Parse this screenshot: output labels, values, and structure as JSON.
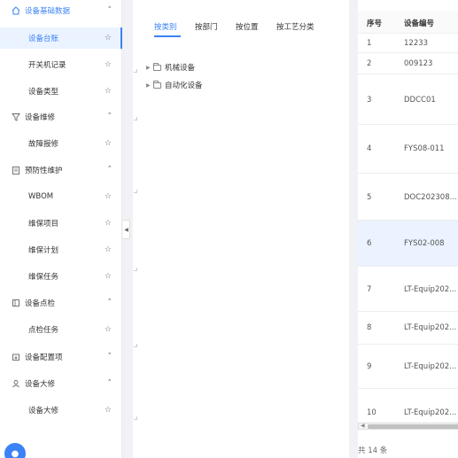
{
  "sidebar": {
    "items": [
      {
        "label": "设备基础数据",
        "icon": "home-icon",
        "right": "˄",
        "kind": "group"
      },
      {
        "label": "设备台账",
        "right": "☆",
        "kind": "sub"
      },
      {
        "label": "开关机记录",
        "right": "☆",
        "kind": "sub"
      },
      {
        "label": "设备类型",
        "right": "☆",
        "kind": "sub"
      },
      {
        "label": "设备维修",
        "icon": "filter-icon",
        "right": "˄",
        "kind": "group"
      },
      {
        "label": "故障报修",
        "right": "☆",
        "kind": "sub"
      },
      {
        "label": "预防性维护",
        "icon": "clipboard-icon",
        "right": "˄",
        "kind": "group"
      },
      {
        "label": "WBOM",
        "right": "☆",
        "kind": "sub"
      },
      {
        "label": "维保项目",
        "right": "☆",
        "kind": "sub"
      },
      {
        "label": "维保计划",
        "right": "☆",
        "kind": "sub"
      },
      {
        "label": "维保任务",
        "right": "☆",
        "kind": "sub"
      },
      {
        "label": "设备点检",
        "icon": "square-icon",
        "right": "˄",
        "kind": "group"
      },
      {
        "label": "点检任务",
        "right": "☆",
        "kind": "sub"
      },
      {
        "label": "设备配置项",
        "icon": "config-icon",
        "right": "˅",
        "kind": "group"
      },
      {
        "label": "设备大修",
        "icon": "user-icon",
        "right": "˄",
        "kind": "group"
      },
      {
        "label": "设备大修",
        "right": "☆",
        "kind": "sub"
      }
    ]
  },
  "tabs": [
    "按类别",
    "按部门",
    "按位置",
    "按工艺分类"
  ],
  "tree": [
    {
      "label": "机械设备"
    },
    {
      "label": "自动化设备"
    }
  ],
  "table": {
    "headers": [
      "序号",
      "设备编号"
    ],
    "rows": [
      {
        "no": "1",
        "code": "12233"
      },
      {
        "no": "2",
        "code": "009123"
      },
      {
        "no": "3",
        "code": "DDCC01"
      },
      {
        "no": "4",
        "code": "FYS08-011"
      },
      {
        "no": "5",
        "code": "DOC202308..."
      },
      {
        "no": "6",
        "code": "FYS02-008"
      },
      {
        "no": "7",
        "code": "LT-Equip202..."
      },
      {
        "no": "8",
        "code": "LT-Equip202..."
      },
      {
        "no": "9",
        "code": "LT-Equip202..."
      },
      {
        "no": "10",
        "code": "LT-Equip202..."
      }
    ],
    "total": "共 14 条"
  },
  "colors": {
    "accent": "#3b82f6",
    "selected_bg": "#eaf3ff"
  }
}
